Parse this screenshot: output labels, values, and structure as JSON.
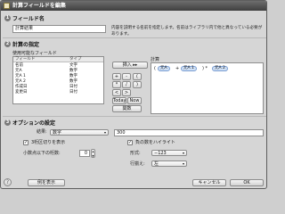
{
  "window": {
    "title": "計算フィールドを編集"
  },
  "section1": {
    "num": "1",
    "title": "フィールド名",
    "field_value": "計算結果",
    "description": "内容を説明する名前を指定します。名前はライブラリ内で他と異なっている必要があります。"
  },
  "section2": {
    "num": "2",
    "title": "計算の指定",
    "fields_label": "使用可能なフィールド",
    "col_field": "フィールド",
    "col_type": "タイプ",
    "rows": [
      {
        "name": "名前",
        "type": "文字"
      },
      {
        "name": "元A",
        "type": "数字"
      },
      {
        "name": "元A 1",
        "type": "数字"
      },
      {
        "name": "元A 2",
        "type": "数字"
      },
      {
        "name": "作成日",
        "type": "日付"
      },
      {
        "name": "変更日",
        "type": "日付"
      }
    ],
    "insert_button": "挿入 ▸▸",
    "op_buttons": [
      "+",
      "-",
      "*",
      "/",
      "<",
      ">"
    ],
    "paren_buttons": [
      "(",
      ")"
    ],
    "today_button": "Today",
    "now_button": "Now",
    "func_button": "関数",
    "calc_label": "計算",
    "formula": {
      "open": "(",
      "token1": "元A",
      "op1": "+",
      "token2": "元A 1",
      "close_mul": ") *",
      "token3": "元A 2"
    }
  },
  "section3": {
    "num": "3",
    "title": "オプションの設定",
    "result_label": "結果:",
    "result_select": "数字",
    "result_value": "300",
    "thousands_checkbox": "3桁区切りを表示",
    "thousands_checked": true,
    "decimals_label": "小数点以下の桁数:",
    "decimals_value": "0",
    "negative_checkbox": "負の数をハイライト",
    "negative_checked": true,
    "format_label": "形式:",
    "format_value": "−123",
    "align_label": "行揃え:",
    "align_value": "左"
  },
  "footer": {
    "help_icon": "?",
    "example_button": "例を表示",
    "cancel_button": "キャンセル",
    "ok_button": "OK"
  }
}
